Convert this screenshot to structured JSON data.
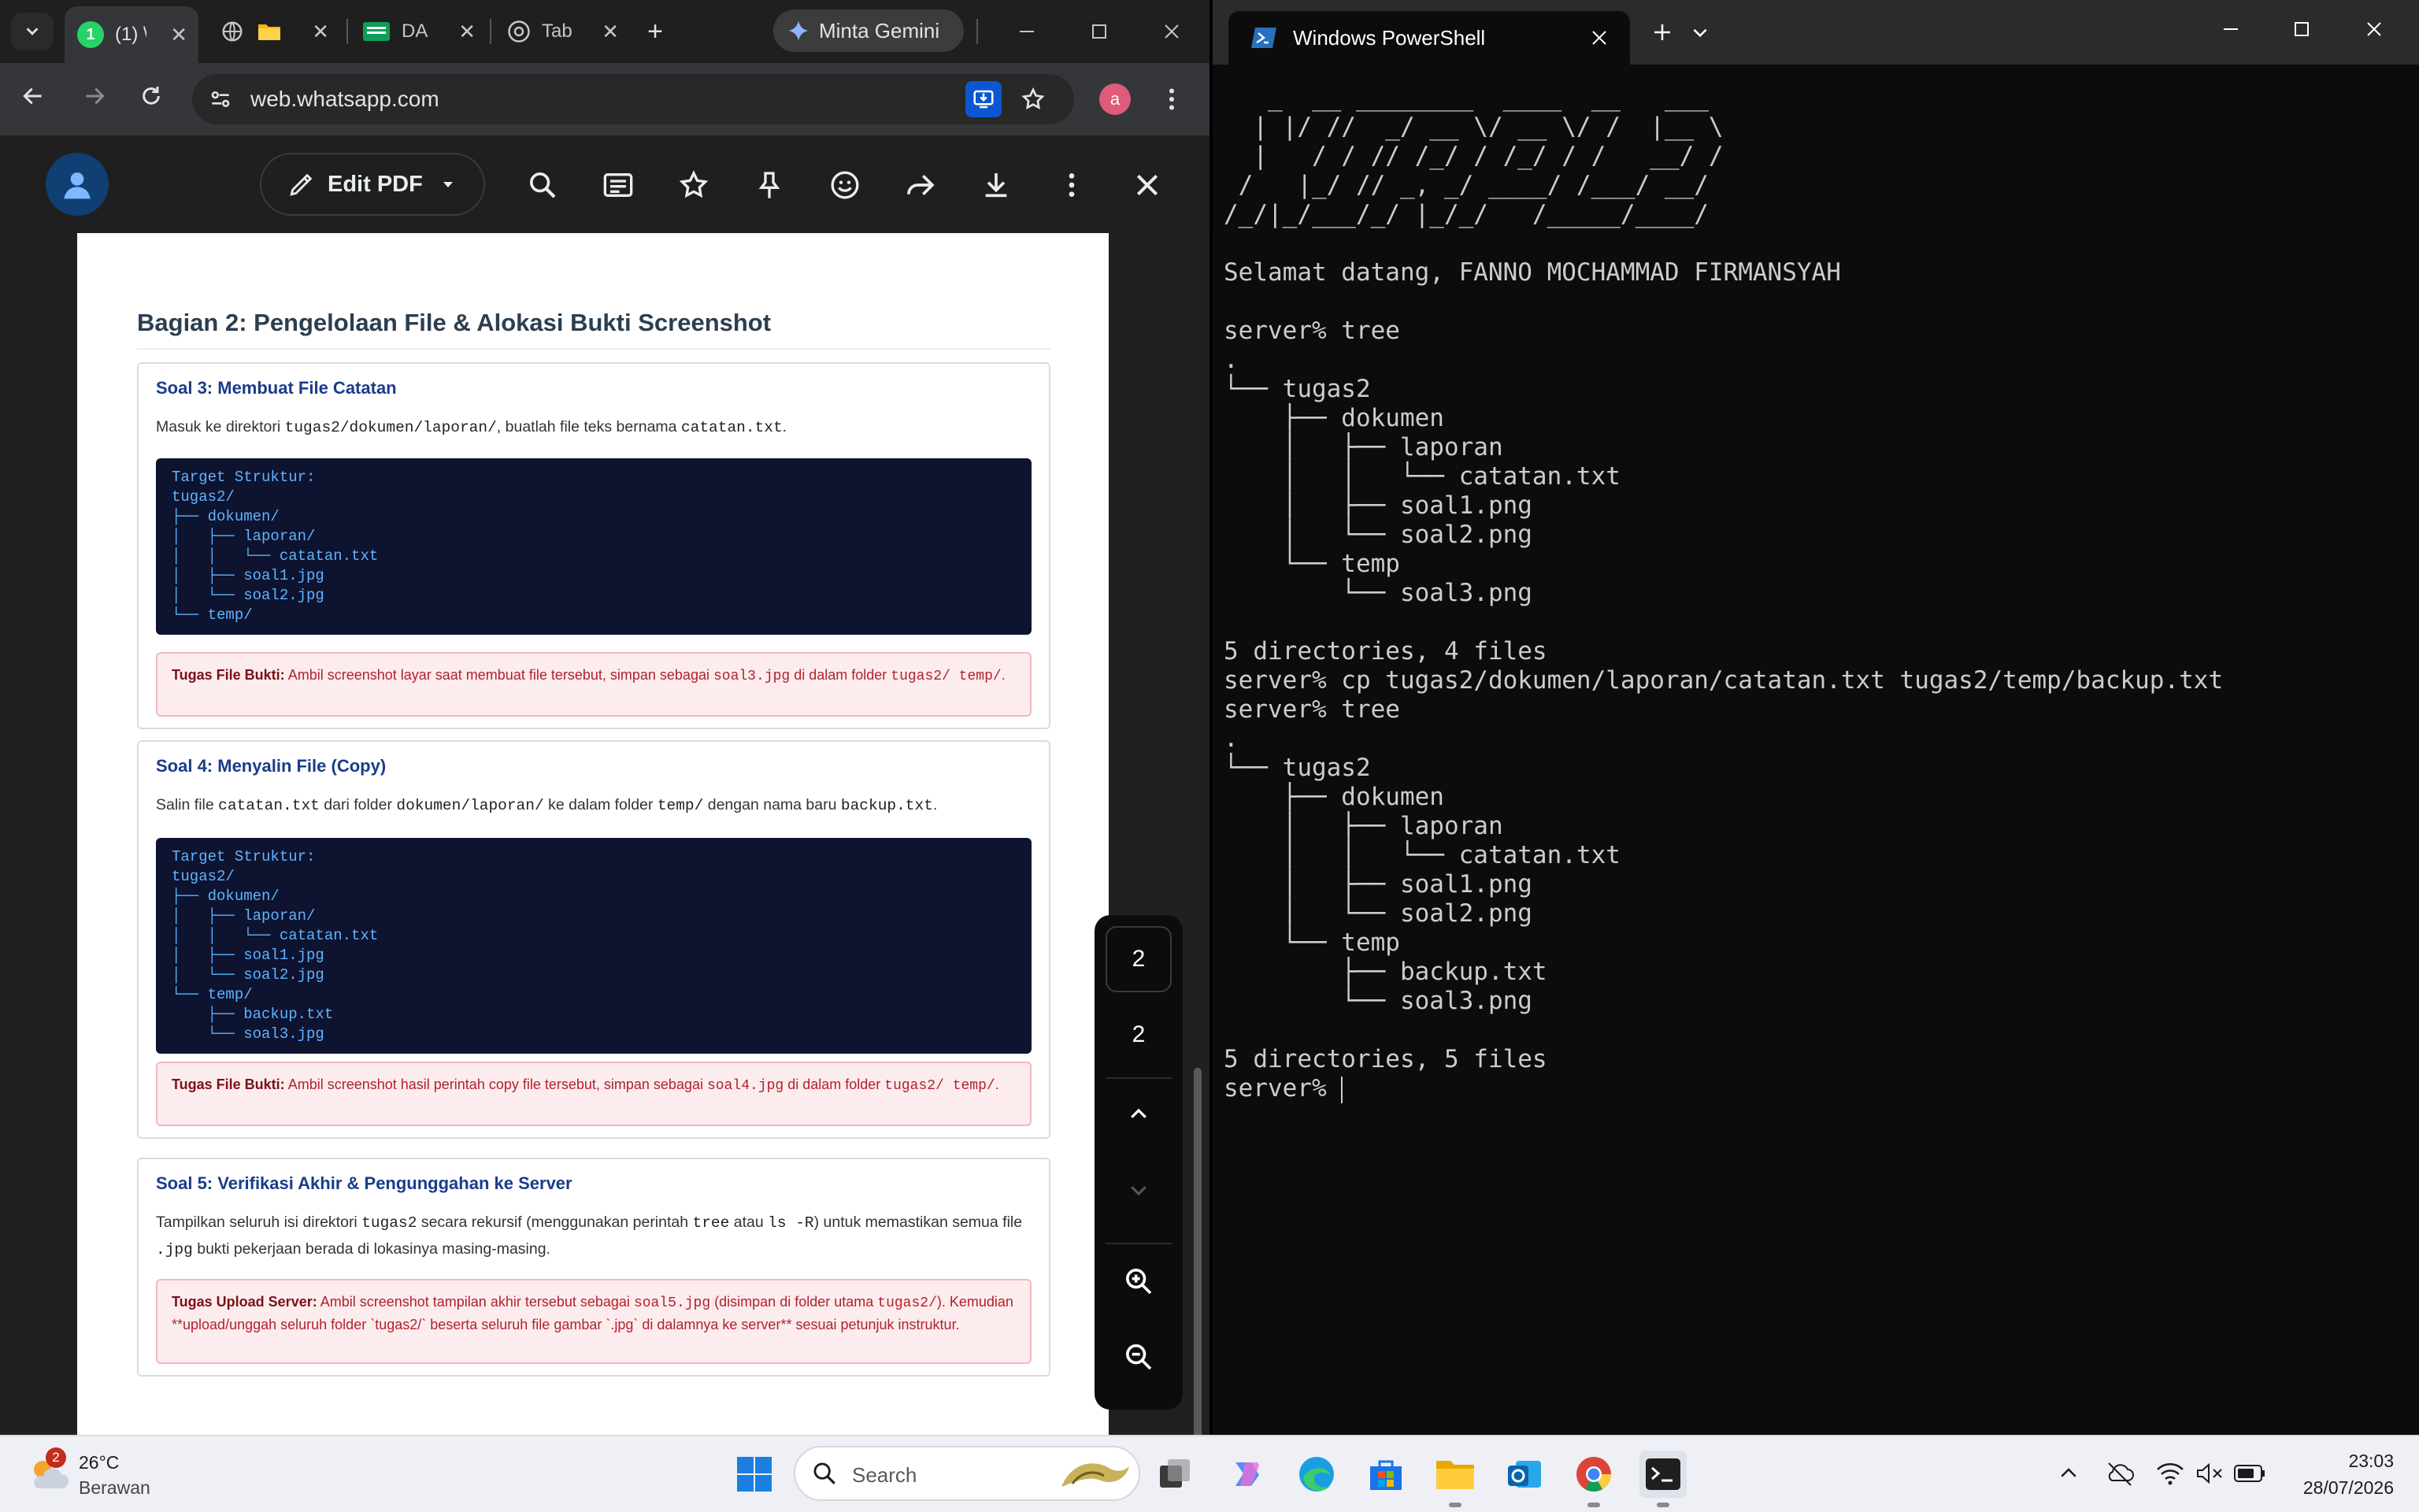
{
  "browser": {
    "tabs": [
      {
        "label": "(1) \\",
        "badge": "1"
      },
      {
        "label": ""
      },
      {
        "label": "DA"
      },
      {
        "label": "Tab"
      }
    ],
    "gemini_label": "Minta Gemini",
    "url": "web.whatsapp.com",
    "profile_letter": "a"
  },
  "viewer_toolbar": {
    "edit_pdf_label": "Edit PDF"
  },
  "document": {
    "heading": "Bagian 2: Pengelolaan File & Alokasi Bukti Screenshot",
    "soal3": {
      "title": "Soal 3: Membuat File Catatan",
      "p_a": "Masuk ke direktori ",
      "p_code1": "tugas2/dokumen/laporan/",
      "p_b": ", buatlah file teks bernama ",
      "p_code2": "catatan.txt",
      "p_c": ".",
      "code": "Target Struktur:\ntugas2/\n├── dokumen/\n│   ├── laporan/\n│   │   └── catatan.txt\n│   ├── soal1.jpg\n│   └── soal2.jpg\n└── temp/",
      "warn_label": "Tugas File Bukti:",
      "warn_a": " Ambil screenshot layar saat membuat file tersebut, simpan sebagai ",
      "warn_code1": "soal3.jpg",
      "warn_b": " di dalam folder ",
      "warn_code2": "tugas2/ temp/",
      "warn_c": "."
    },
    "soal4": {
      "title": "Soal 4: Menyalin File (Copy)",
      "p_a": "Salin file ",
      "p_code1": "catatan.txt",
      "p_b": " dari folder ",
      "p_code2": "dokumen/laporan/",
      "p_c": " ke dalam folder ",
      "p_code3": "temp/",
      "p_d": " dengan nama baru ",
      "p_code4": "backup.txt",
      "p_e": ".",
      "code": "Target Struktur:\ntugas2/\n├── dokumen/\n│   ├── laporan/\n│   │   └── catatan.txt\n│   ├── soal1.jpg\n│   └── soal2.jpg\n└── temp/\n    ├── backup.txt\n    └── soal3.jpg",
      "warn_label": "Tugas File Bukti:",
      "warn_a": " Ambil screenshot hasil perintah copy file tersebut, simpan sebagai ",
      "warn_code1": "soal4.jpg",
      "warn_b": " di dalam folder ",
      "warn_code2": "tugas2/ temp/",
      "warn_c": "."
    },
    "soal5": {
      "title": "Soal 5: Verifikasi Akhir & Pengunggahan ke Server",
      "p_a": "Tampilkan seluruh isi direktori ",
      "p_code1": "tugas2",
      "p_b": " secara rekursif (menggunakan perintah ",
      "p_code2": "tree",
      "p_c": " atau ",
      "p_code3": "ls -R",
      "p_d": ") untuk memastikan semua file ",
      "p_code4": ".jpg",
      "p_e": " bukti pekerjaan berada di lokasinya masing-masing.",
      "warn_label": "Tugas Upload Server:",
      "warn_a": " Ambil screenshot tampilan akhir tersebut sebagai ",
      "warn_code1": "soal5.jpg",
      "warn_b": " (disimpan di folder utama ",
      "warn_code2": "tugas2/",
      "warn_c": "). Kemudian **upload/unggah seluruh folder `tugas2/` beserta seluruh file gambar `.jpg` di dalamnya ke server** sesuai petunjuk instruktur."
    }
  },
  "page_nav": {
    "current": "2",
    "total": "2"
  },
  "powershell": {
    "tab_title": "Windows PowerShell",
    "output": "   _  __ ________  ____  __   ___\n  | |/ //  _/ __ \\/ __ \\/ /  |__ \\\n  |   / / // /_/ / /_/ / /   __/ /\n /   |_/ // _, _/ ____/ /___/ __/\n/_/|_/___/_/ |_/_/   /_____/____/\n\nSelamat datang, FANNO MOCHAMMAD FIRMANSYAH\n\nserver% tree\n.\n└── tugas2\n    ├── dokumen\n    │   ├── laporan\n    │   │   └── catatan.txt\n    │   ├── soal1.png\n    │   └── soal2.png\n    └── temp\n        └── soal3.png\n\n5 directories, 4 files\nserver% cp tugas2/dokumen/laporan/catatan.txt tugas2/temp/backup.txt\nserver% tree\n.\n└── tugas2\n    ├── dokumen\n    │   ├── laporan\n    │   │   └── catatan.txt\n    │   ├── soal1.png\n    │   └── soal2.png\n    └── temp\n        ├── backup.txt\n        └── soal3.png\n\n5 directories, 5 files\nserver% "
  },
  "taskbar": {
    "weather_badge": "2",
    "temperature": "26°C",
    "condition": "Berawan",
    "search_placeholder": "Search",
    "time": "23:03",
    "date": "28/07/2026"
  },
  "colors": {
    "whatsapp_green": "#25d366",
    "pdf_heading": "#2c3e50",
    "card_title": "#1a3c8a",
    "code_bg": "#0e1330",
    "code_text": "#5fb4ff",
    "warn_bg": "#fdeced",
    "warn_text": "#b0222d",
    "terminal_bg": "#0c0c0c"
  }
}
